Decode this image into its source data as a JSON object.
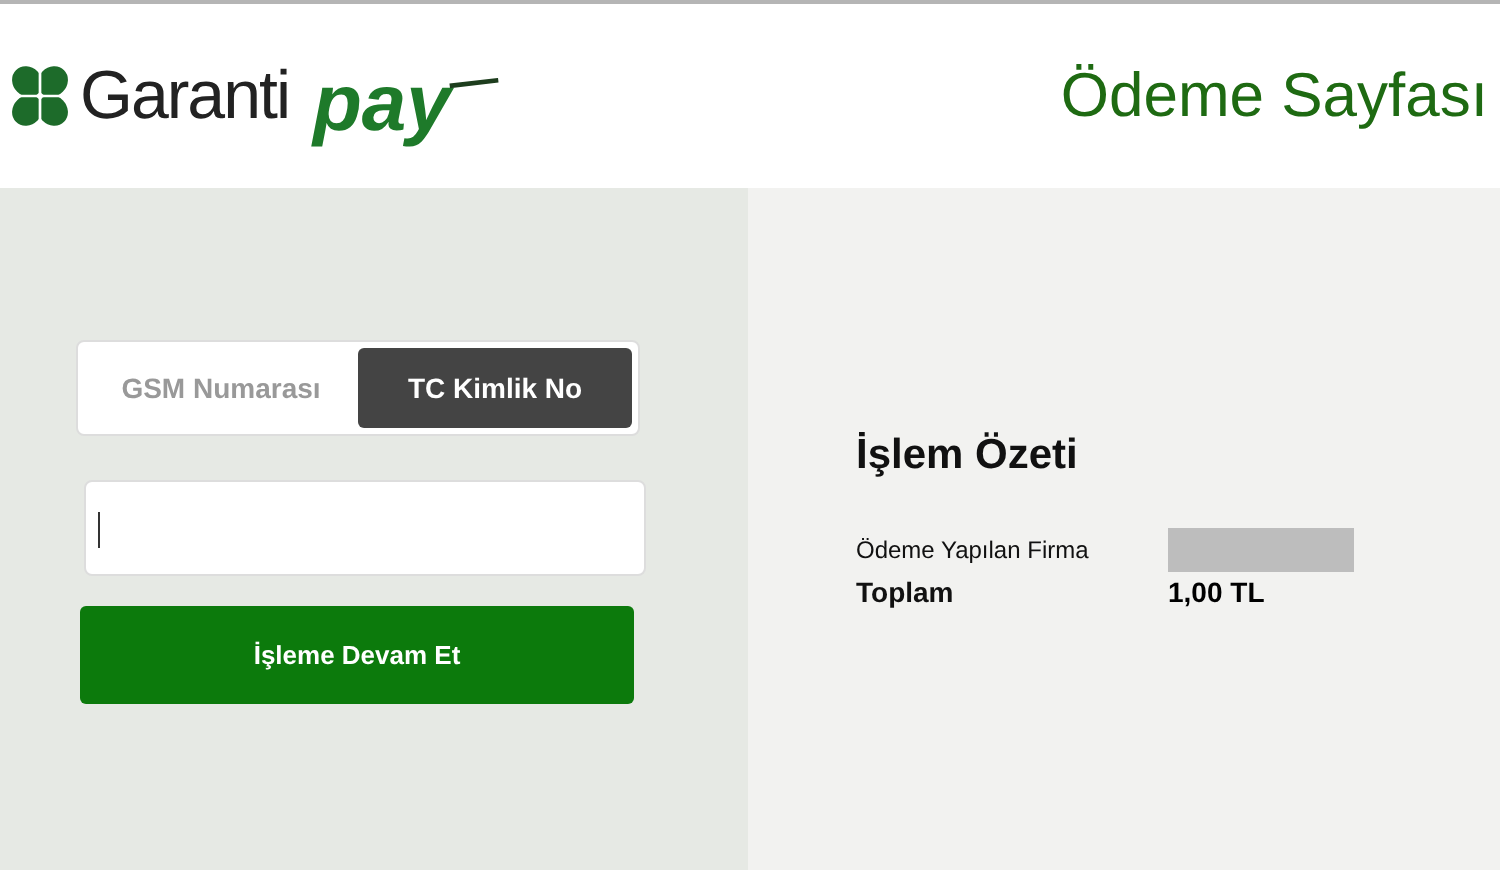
{
  "header": {
    "logo_text": "Garanti",
    "logo_pay": "pay",
    "title": "Ödeme Sayfası"
  },
  "tabs": [
    {
      "label": "GSM Numarası",
      "selected": false
    },
    {
      "label": "TC Kimlik No",
      "selected": true
    }
  ],
  "continue_button": "İşleme Devam Et",
  "summary": {
    "title": "İşlem Özeti",
    "rows": [
      {
        "label": "Ödeme Yapılan Firma",
        "kind": "redacted"
      },
      {
        "label": "Toplam",
        "kind": "total",
        "value": "1,00 TL"
      }
    ]
  }
}
